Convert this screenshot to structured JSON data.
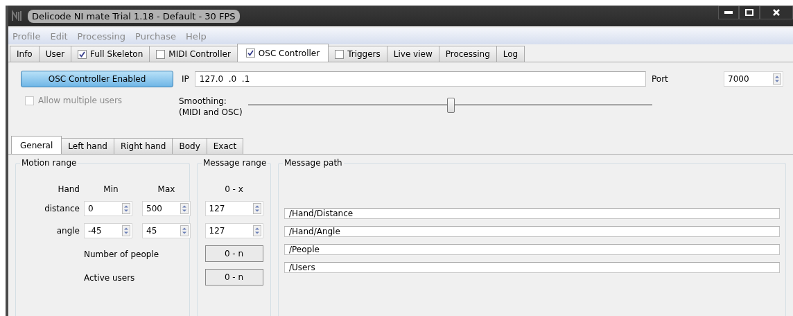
{
  "window": {
    "title": "Delicode NI mate Trial 1.18 - Default - 30 FPS"
  },
  "menu": [
    {
      "label": "Profile",
      "disabled": true
    },
    {
      "label": "Edit",
      "disabled": true
    },
    {
      "label": "Processing",
      "disabled": true
    },
    {
      "label": "Purchase",
      "disabled": true
    },
    {
      "label": "Help",
      "disabled": true
    }
  ],
  "tabs": [
    {
      "label": "Info",
      "kind": "plain",
      "selected": false
    },
    {
      "label": "User",
      "kind": "plain",
      "selected": false
    },
    {
      "label": "Full Skeleton",
      "kind": "checkbox",
      "checked": true,
      "selected": false
    },
    {
      "label": "MIDI Controller",
      "kind": "checkbox",
      "checked": false,
      "selected": false
    },
    {
      "label": "OSC Controller",
      "kind": "checkbox",
      "checked": true,
      "selected": true
    },
    {
      "label": "Triggers",
      "kind": "checkbox",
      "checked": false,
      "selected": false
    },
    {
      "label": "Live view",
      "kind": "plain",
      "selected": false
    },
    {
      "label": "Processing",
      "kind": "plain",
      "selected": false
    },
    {
      "label": "Log",
      "kind": "plain",
      "selected": false
    }
  ],
  "osc": {
    "enable_button": {
      "label": "OSC Controller Enabled",
      "on": true
    },
    "ip_label": "IP",
    "ip": "127.0  .0  .1",
    "port_label": "Port",
    "port": "7000",
    "allow_multiple": {
      "label": "Allow multiple users",
      "checked": false,
      "disabled": true
    },
    "smoothing": {
      "label": "Smoothing:",
      "sublabel": "(MIDI and OSC)",
      "level": 0.5
    }
  },
  "subtabs": [
    {
      "label": "General",
      "selected": true
    },
    {
      "label": "Left hand",
      "selected": false
    },
    {
      "label": "Right hand",
      "selected": false
    },
    {
      "label": "Body",
      "selected": false
    },
    {
      "label": "Exact",
      "selected": false
    }
  ],
  "motion_range": {
    "title": "Motion range",
    "headers": [
      "Hand",
      "Min",
      "Max"
    ],
    "rows": [
      {
        "label": "distance",
        "min": "0",
        "max": "500"
      },
      {
        "label": "angle",
        "min": "-45",
        "max": "45"
      }
    ],
    "notes": [
      "Number of people",
      "Active users"
    ]
  },
  "message_range": {
    "title": "Message range",
    "header": "0 - x",
    "values": [
      {
        "kind": "spin",
        "text": "127"
      },
      {
        "kind": "spin",
        "text": "127"
      },
      {
        "kind": "fixed",
        "text": "0 - n"
      },
      {
        "kind": "fixed",
        "text": "0 - n"
      }
    ]
  },
  "message_path": {
    "title": "Message path",
    "paths": [
      "/Hand/Distance",
      "/Hand/Angle",
      "/People",
      "/Users"
    ]
  }
}
